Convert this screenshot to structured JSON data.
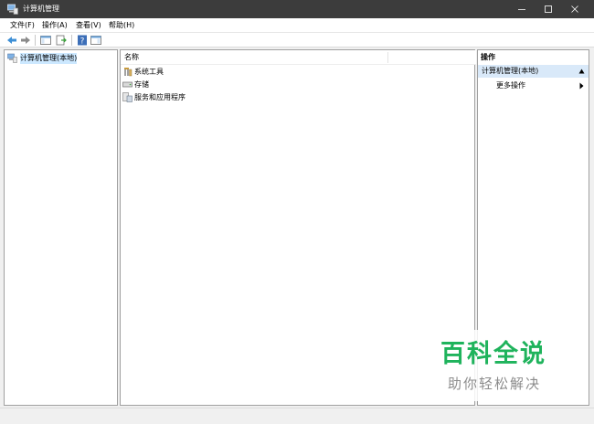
{
  "window": {
    "title": "计算机管理",
    "icon": "computer-management-icon",
    "titlebar_color": "#3c3c3c",
    "controls": [
      "minimize-icon",
      "maximize-icon",
      "close-icon"
    ]
  },
  "menubar": {
    "items": [
      {
        "label": "文件(F)"
      },
      {
        "label": "操作(A)"
      },
      {
        "label": "查看(V)"
      },
      {
        "label": "帮助(H)"
      }
    ]
  },
  "toolbar": {
    "buttons": [
      "back-arrow-icon",
      "forward-arrow-icon",
      "show-hide-tree-icon",
      "export-list-icon",
      "help-icon",
      "show-hide-action-pane-icon"
    ]
  },
  "tree": {
    "items": [
      {
        "label": "计算机管理(本地)",
        "icon": "computer-management-icon",
        "selected": true
      }
    ],
    "selection_color": "#cce8ff"
  },
  "main": {
    "column_header": "名称",
    "rows": [
      {
        "label": "系统工具",
        "icon": "system-tools-icon"
      },
      {
        "label": "存储",
        "icon": "storage-icon"
      },
      {
        "label": "服务和应用程序",
        "icon": "services-apps-icon"
      }
    ]
  },
  "actions": {
    "title": "操作",
    "section": {
      "label": "计算机管理(本地)",
      "color": "#d9e9f9"
    },
    "items": [
      {
        "label": "更多操作"
      }
    ]
  },
  "watermark": {
    "title": "百科全说",
    "subtitle": "助你轻松解决",
    "title_color": "#1fb35c"
  }
}
